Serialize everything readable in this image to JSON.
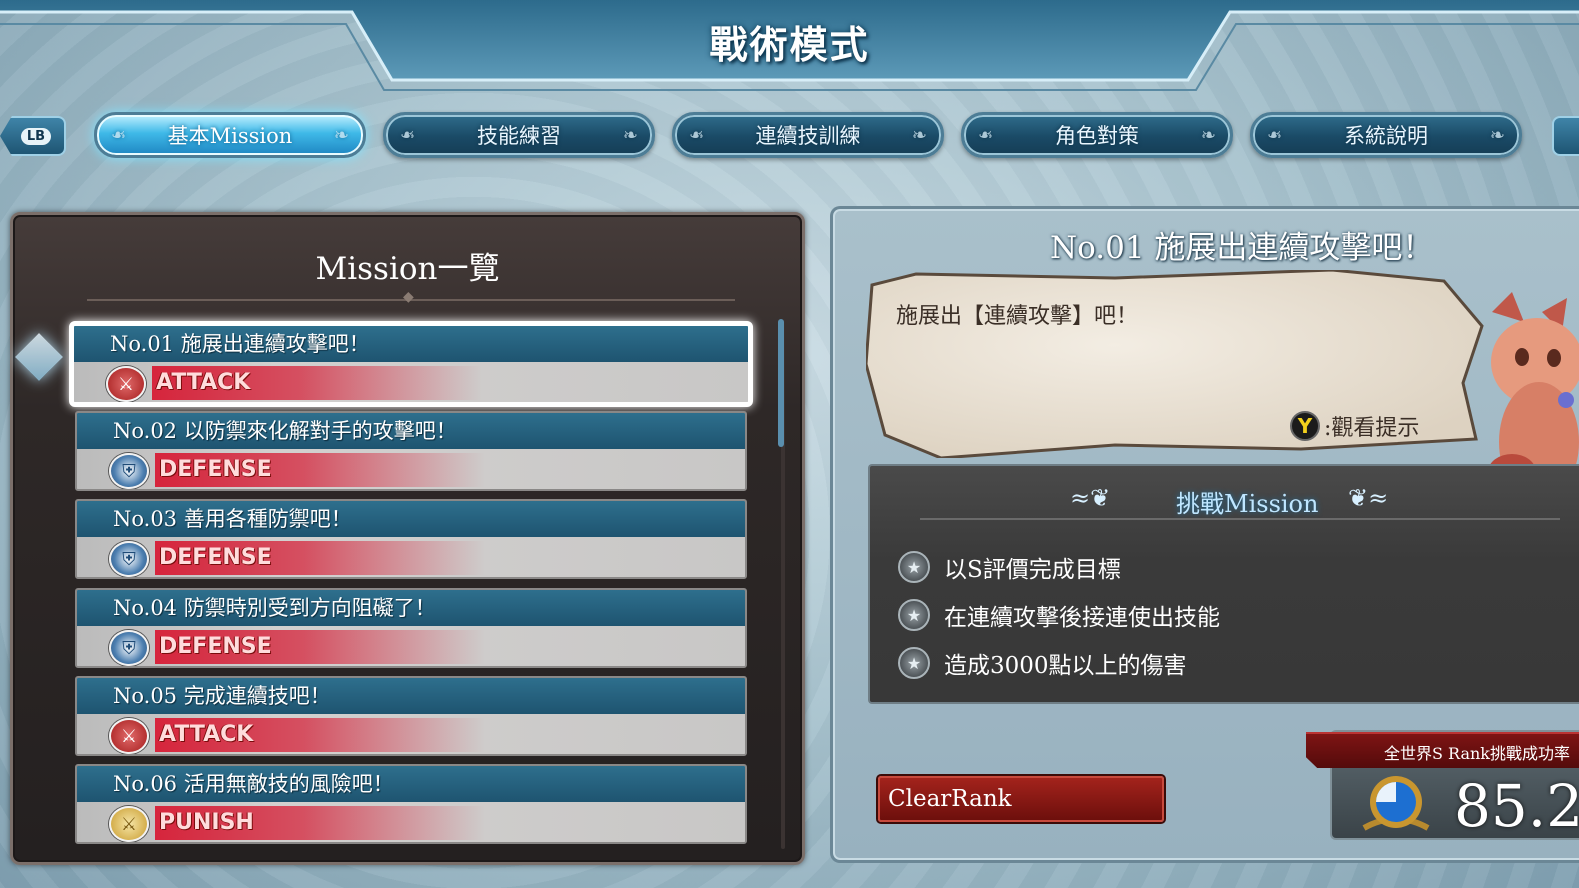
{
  "header": {
    "title": "戰術模式"
  },
  "tabs": {
    "lb_label": "LB",
    "items": [
      {
        "label": "基本Mission"
      },
      {
        "label": "技能練習"
      },
      {
        "label": "連續技訓練"
      },
      {
        "label": "角色對策"
      },
      {
        "label": "系統說明"
      }
    ]
  },
  "mission_list": {
    "title": "Mission一覽",
    "items": [
      {
        "label": "No.01 施展出連續攻擊吧！",
        "type": "ATTACK"
      },
      {
        "label": "No.02 以防禦來化解對手的攻擊吧！",
        "type": "DEFENSE"
      },
      {
        "label": "No.03 善用各種防禦吧！",
        "type": "DEFENSE"
      },
      {
        "label": "No.04 防禦時別受到方向阻礙了！",
        "type": "DEFENSE"
      },
      {
        "label": "No.05 完成連續技吧！",
        "type": "ATTACK"
      },
      {
        "label": "No.06 活用無敵技的風險吧！",
        "type": "PUNISH"
      }
    ]
  },
  "detail": {
    "title": "No.01 施展出連續攻擊吧！",
    "speech": "施展出【連續攻擊】吧！",
    "hint_button": "Y",
    "hint_label": ":觀看提示",
    "challenge_title": "挑戰Mission",
    "challenges": [
      "以S評價完成目標",
      "在連續攻擊後接連使出技能",
      "造成3000點以上的傷害"
    ],
    "clear_rank_label": "ClearRank",
    "success_rate_label": "全世界S Rank挑戰成功率",
    "success_rate_value": "85.2"
  },
  "colors": {
    "attack": "#d6253c",
    "tab_active": "#3fb9e8",
    "mission_header": "#1e5470"
  }
}
